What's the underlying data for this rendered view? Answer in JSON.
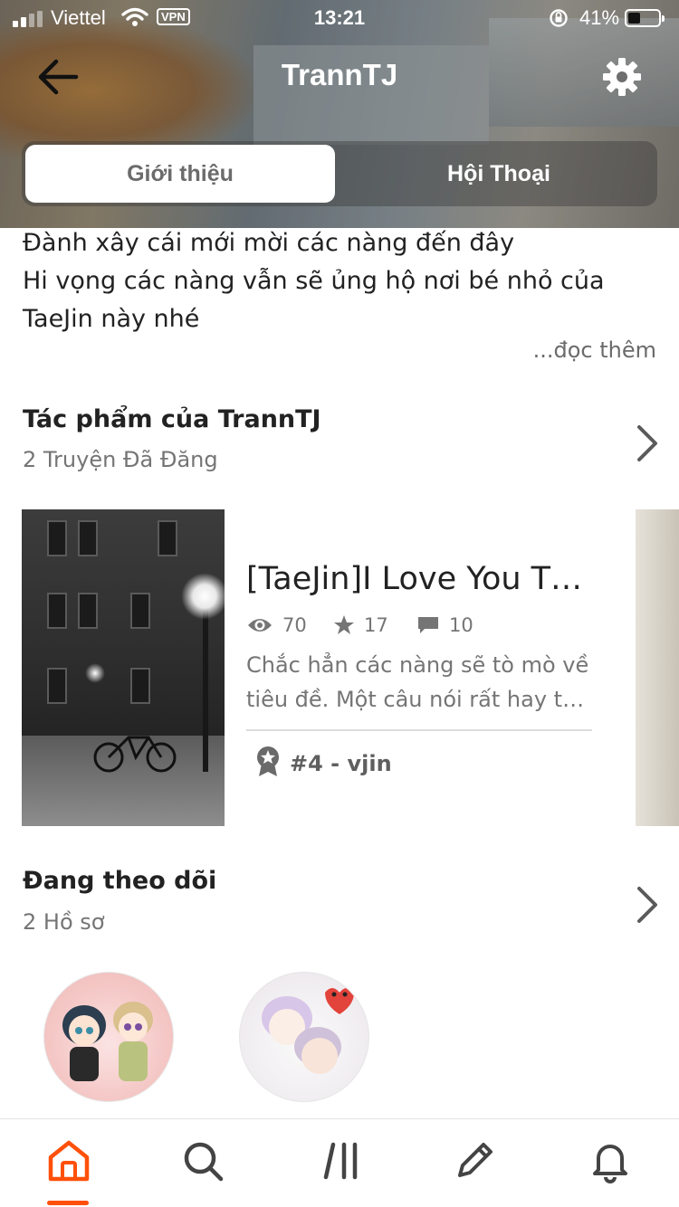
{
  "status_bar": {
    "carrier": "Viettel",
    "vpn": "VPN",
    "time": "13:21",
    "battery_percent": "41%",
    "battery_level": 0.41
  },
  "header": {
    "title": "TrannTJ",
    "tabs": [
      {
        "label": "Giới thiệu",
        "active": true
      },
      {
        "label": "Hội Thoại",
        "active": false
      }
    ]
  },
  "about": {
    "lines": [
      "Đành xây cái mới mời các nàng đến đây",
      "Hi vọng các nàng vẫn sẽ ủng hộ nơi bé nhỏ của",
      "TaeJin này nhé"
    ],
    "read_more": "...đọc thêm"
  },
  "works": {
    "title": "Tác phẩm của TrannTJ",
    "subtitle": "2 Truyện Đã Đăng",
    "stories": [
      {
        "title": "[TaeJin]I Love You T…",
        "reads": "70",
        "votes": "17",
        "comments": "10",
        "description_lines": [
          "Chắc hẳn các nàng sẽ tò mò về",
          "tiêu đề. Một câu nói rất hay tôi…"
        ],
        "rank": "#4 - vjin"
      }
    ]
  },
  "following": {
    "title": "Đang theo dõi",
    "subtitle": "2 Hồ sơ"
  },
  "colors": {
    "accent": "#ff500a",
    "text_primary": "#222222",
    "text_secondary": "#757575"
  },
  "bottom_nav": [
    {
      "icon": "home-icon",
      "active": true
    },
    {
      "icon": "search-icon",
      "active": false
    },
    {
      "icon": "library-icon",
      "active": false
    },
    {
      "icon": "pencil-icon",
      "active": false
    },
    {
      "icon": "bell-icon",
      "active": false
    }
  ]
}
